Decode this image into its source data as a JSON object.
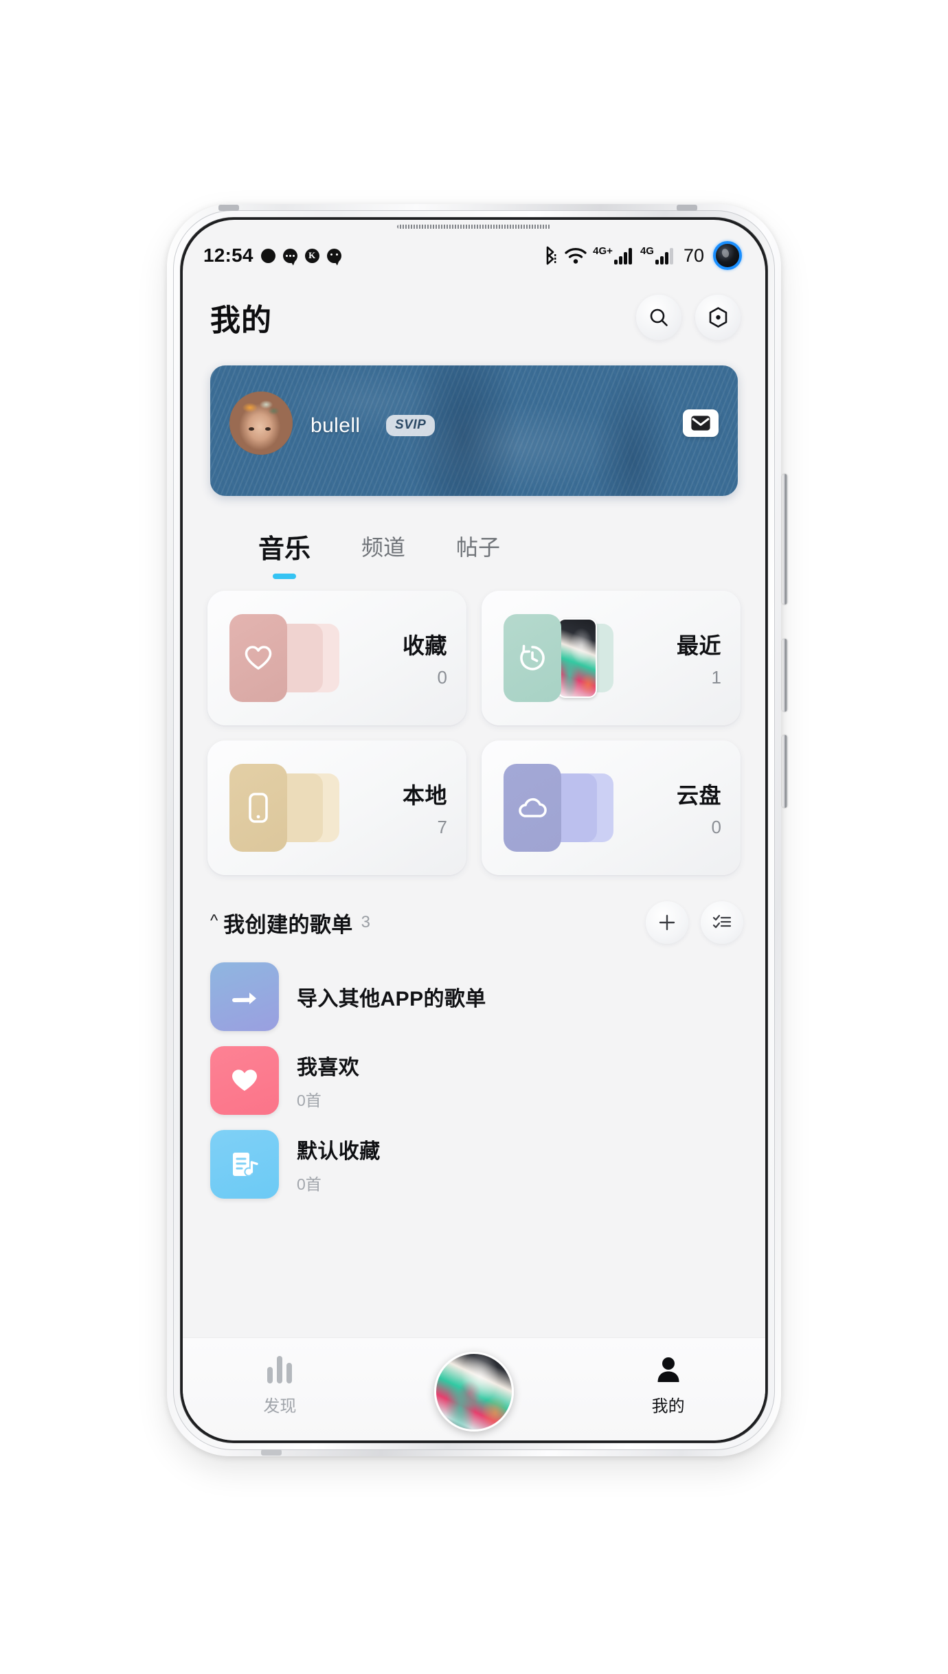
{
  "status_bar": {
    "time": "12:54",
    "left_icons": [
      "notification-dot-icon",
      "message-dots-icon",
      "kuwo-k-icon",
      "chat-bubble-icon"
    ],
    "right_icons": [
      "bluetooth-icon",
      "wifi-icon",
      "signal-4g-plus-icon",
      "signal-4g-icon"
    ],
    "network_label_1": "4G+",
    "network_label_2": "4G",
    "battery": "70"
  },
  "header": {
    "title": "我的",
    "search_icon": "search-icon",
    "settings_icon": "hexagon-settings-icon"
  },
  "profile": {
    "name": "bulell",
    "badge": "SVIP",
    "mail_icon": "mail-envelope-icon"
  },
  "tabs": [
    {
      "label": "音乐",
      "active": true
    },
    {
      "label": "频道",
      "active": false
    },
    {
      "label": "帖子",
      "active": false
    }
  ],
  "cards": [
    {
      "label": "收藏",
      "count": "0",
      "icon": "heart-outline-icon",
      "palette": "p-pink"
    },
    {
      "label": "最近",
      "count": "1",
      "icon": "clock-history-icon",
      "palette": "p-mint"
    },
    {
      "label": "本地",
      "count": "7",
      "icon": "phone-device-icon",
      "palette": "p-tan"
    },
    {
      "label": "云盘",
      "count": "0",
      "icon": "cloud-icon",
      "palette": "p-purp"
    }
  ],
  "section": {
    "collapse_icon": "chevron-up-icon",
    "title": "我创建的歌单",
    "count": "3",
    "add_icon": "plus-icon",
    "manage_icon": "checklist-icon"
  },
  "playlists": [
    {
      "name": "导入其他APP的歌单",
      "sub": "",
      "icon": "import-arrow-icon",
      "style": "import"
    },
    {
      "name": "我喜欢",
      "sub": "0首",
      "icon": "heart-filled-icon",
      "style": "like"
    },
    {
      "name": "默认收藏",
      "sub": "0首",
      "icon": "music-note-list-icon",
      "style": "defcol"
    }
  ],
  "bottom_nav": [
    {
      "label": "发现",
      "icon": "waveform-icon",
      "active": false
    },
    {
      "label": "",
      "icon": "album-art-icon",
      "active": false
    },
    {
      "label": "我的",
      "icon": "person-icon",
      "active": true
    }
  ],
  "colors": {
    "accent": "#35c3f3",
    "banner": "#3a6b93",
    "like": "#fd8294",
    "default_collection": "#7fd0f6"
  }
}
